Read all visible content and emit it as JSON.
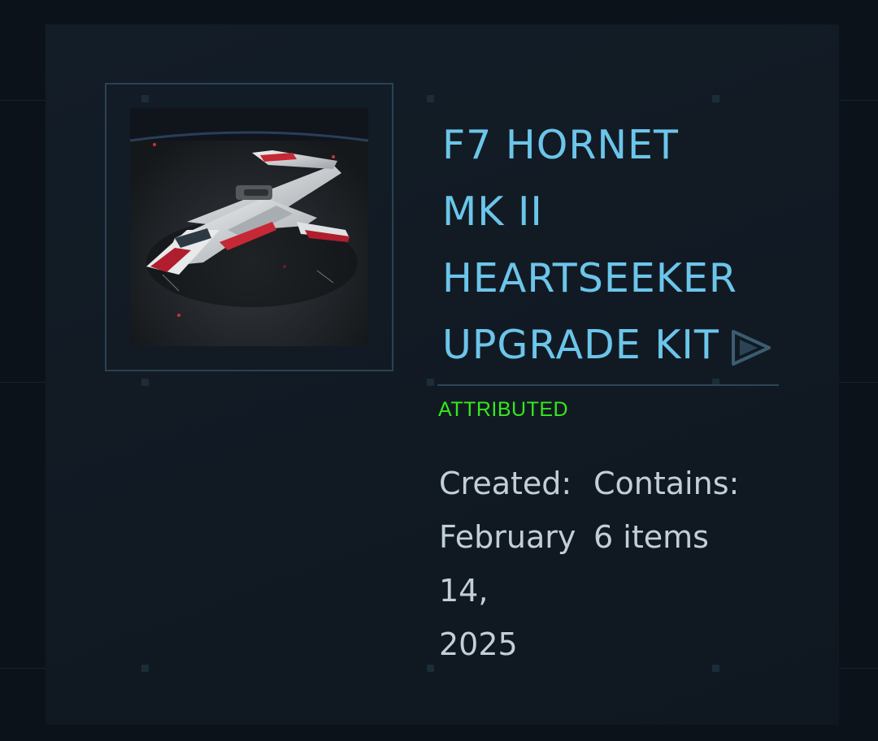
{
  "item": {
    "title_lines": [
      "F7 HORNET",
      "MK II",
      "HEARTSEEKER",
      "UPGRADE KIT"
    ],
    "thumbnail_alt": "F7 Hornet Mk II Heartseeker ship render",
    "status": "ATTRIBUTED",
    "created": {
      "label": "Created:",
      "value_lines": [
        "February",
        "14,",
        "2025"
      ]
    },
    "contains": {
      "label": "Contains:",
      "value_lines": [
        "6 items"
      ]
    }
  },
  "icons": {
    "next": "play-triangle-icon"
  },
  "colors": {
    "title": "#6cc5ea",
    "status": "#35e81c",
    "meta_text": "#c2cfd8",
    "card_bg": "#121c26",
    "frame": "#2a4253",
    "accent_red": "#d22a3a"
  }
}
